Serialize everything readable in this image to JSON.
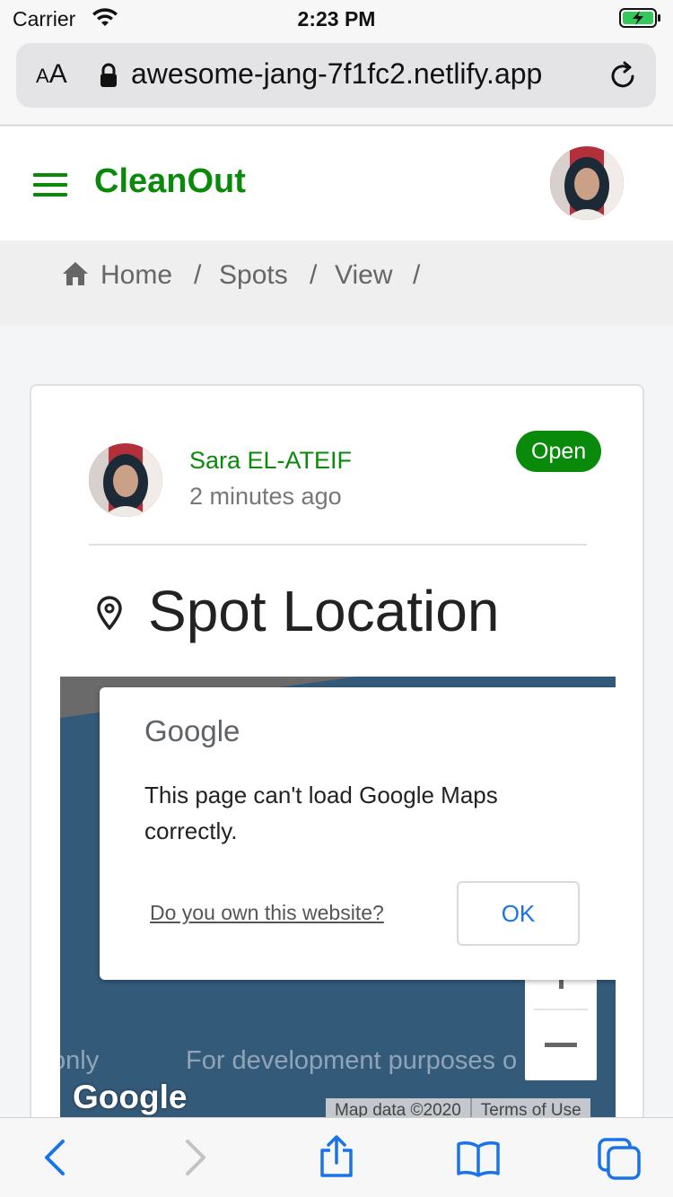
{
  "status_bar": {
    "carrier": "Carrier",
    "time": "2:23 PM"
  },
  "address_bar": {
    "text_size_small": "A",
    "text_size_large": "A",
    "url": "awesome-jang-7f1fc2.netlify.app"
  },
  "app": {
    "title": "CleanOut",
    "accent_color": "#0a8a0a"
  },
  "breadcrumb": {
    "items": [
      "Home",
      "Spots",
      "View"
    ],
    "separator": "/"
  },
  "post": {
    "author": "Sara EL-ATEIF",
    "time_ago": "2 minutes ago",
    "status": "Open",
    "section_title": "Spot Location"
  },
  "map": {
    "dialog": {
      "brand": "Google",
      "message": "This page can't load Google Maps correctly.",
      "link": "Do you own this website?",
      "ok": "OK"
    },
    "watermark_left": "only",
    "watermark_right": "For development purposes o",
    "logo": "Google",
    "attribution": {
      "data": "Map data ©2020",
      "terms": "Terms of Use"
    }
  }
}
